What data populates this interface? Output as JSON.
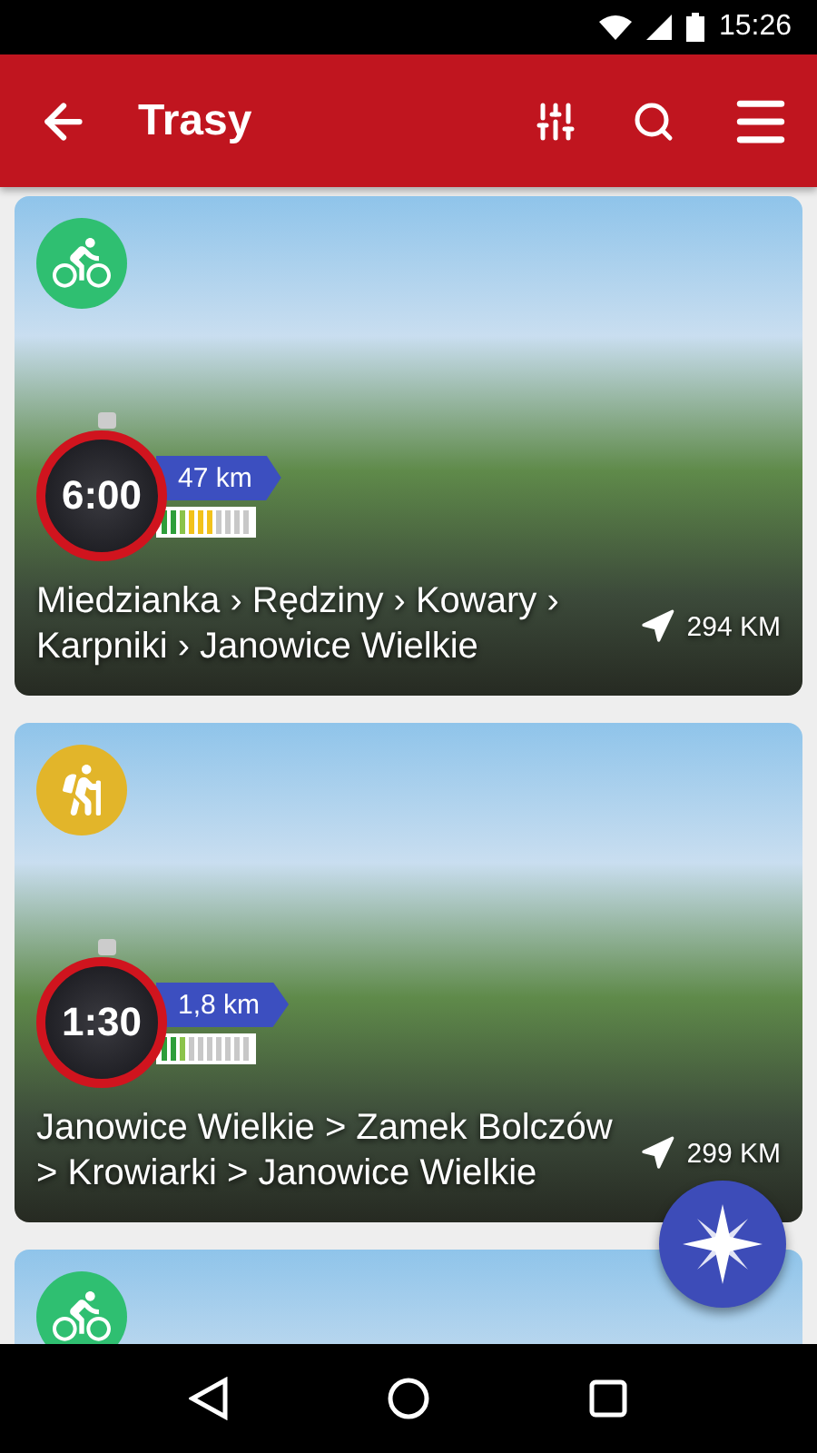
{
  "status_bar": {
    "time": "15:26"
  },
  "app_bar": {
    "title": "Trasy"
  },
  "routes": [
    {
      "kind": "bike",
      "color": "#2fbf71",
      "duration": "6:00",
      "distance": "47 km",
      "level": 0.6,
      "title": "Miedzianka › Rędziny › Kowary › Karpniki › Janowice Wielkie",
      "length": "294 KM"
    },
    {
      "kind": "hike",
      "color": "#e2b52a",
      "duration": "1:30",
      "distance": "1,8 km",
      "level": 0.3,
      "title": "Janowice Wielkie > Zamek Bolczów > Krowiarki > Janowice Wielkie",
      "length": "299 KM"
    },
    {
      "kind": "bike",
      "color": "#2fbf71"
    }
  ]
}
